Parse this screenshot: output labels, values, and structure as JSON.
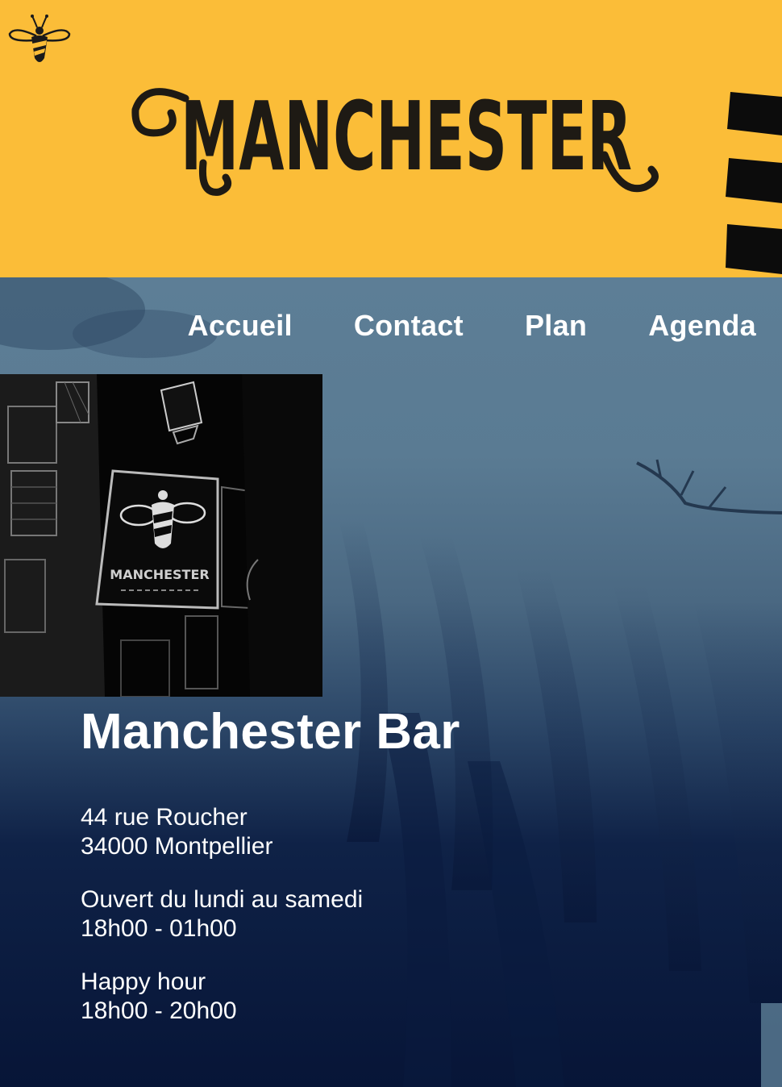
{
  "brand": {
    "logo_text": "MANCHESTER",
    "accent_color": "#fbbd38",
    "icon": "bee-icon"
  },
  "nav": {
    "items": [
      {
        "label": "Accueil"
      },
      {
        "label": "Contact"
      },
      {
        "label": "Plan"
      },
      {
        "label": "Agenda"
      }
    ]
  },
  "photo": {
    "sign_text": "MANCHESTER"
  },
  "info": {
    "title": "Manchester Bar",
    "address_line1": "44 rue Roucher",
    "address_line2": "34000 Montpellier",
    "hours_label": "Ouvert du lundi au samedi",
    "hours_value": "18h00 - 01h00",
    "happy_label": "Happy hour",
    "happy_value": "18h00 - 20h00"
  }
}
